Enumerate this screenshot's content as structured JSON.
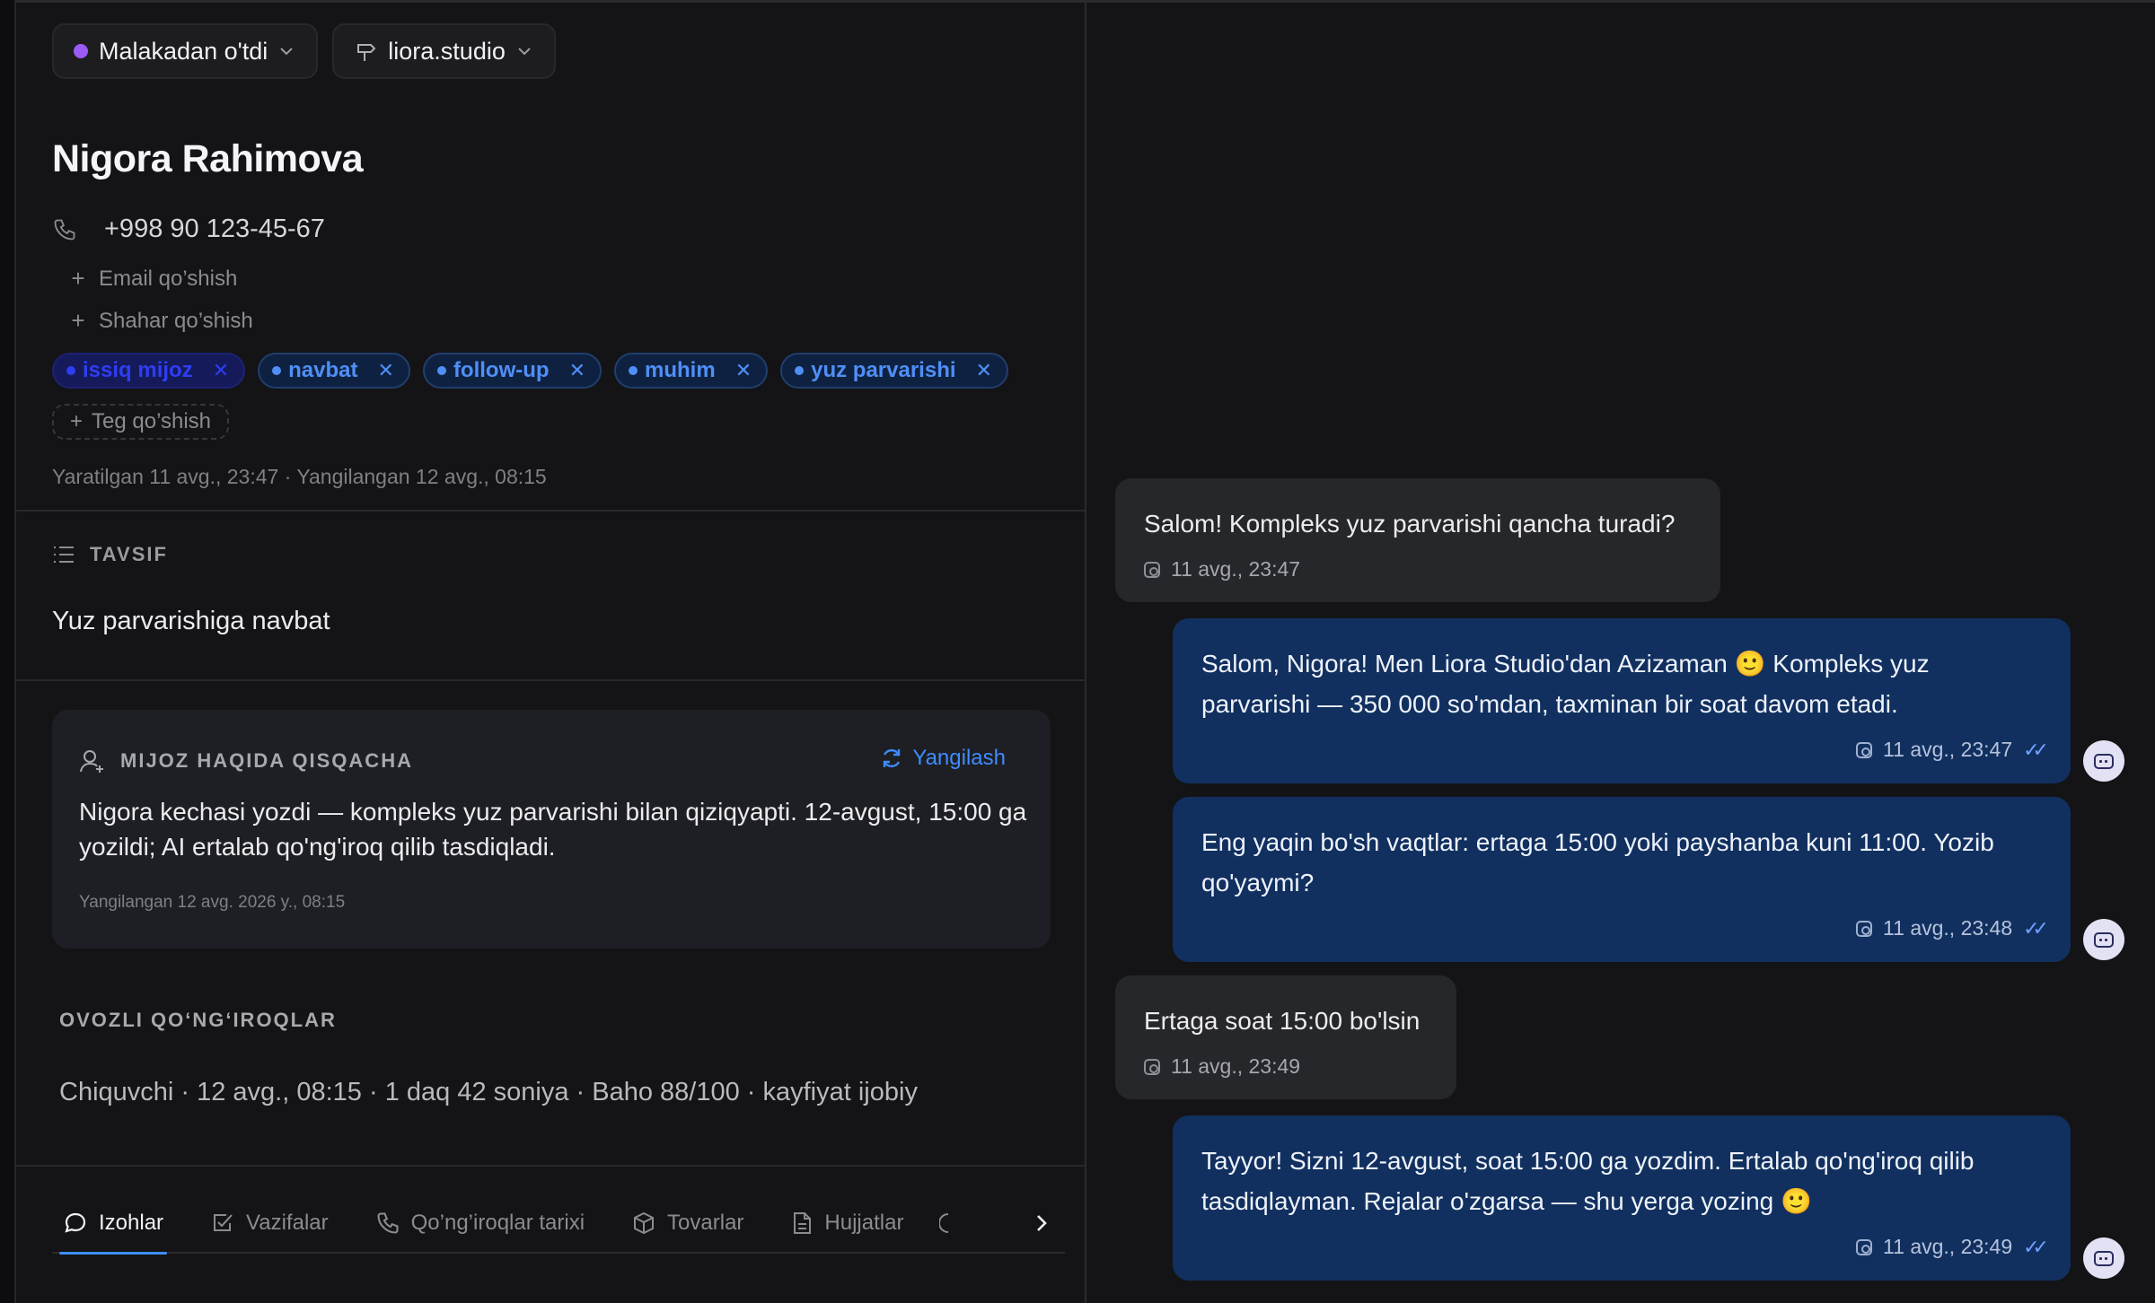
{
  "header": {
    "status_label": "Malakadan o'tdi",
    "status_color": "#9b5cf6",
    "channel_label": "liora.studio"
  },
  "contact": {
    "name": "Nigora Rahimova",
    "phone": "+998 90 123-45-67",
    "add_email": "Email qo’shish",
    "add_city": "Shahar qo’shish",
    "tags": [
      "issiq mijoz",
      "navbat",
      "follow-up",
      "muhim",
      "yuz parvarishi"
    ],
    "add_tag": "Teg qo’shish",
    "meta": "Yaratilgan 11 avg., 23:47 · Yangilangan 12 avg., 08:15"
  },
  "description": {
    "heading": "TAVSIF",
    "text": "Yuz parvarishiga navbat"
  },
  "summary": {
    "heading": "MIJOZ HAQIDA QISQACHA",
    "refresh_label": "Yangilash",
    "text": "Nigora kechasi yozdi — kompleks yuz parvarishi bilan qiziqyapti. 12-avgust, 15:00 ga yozildi; AI ertalab qo'ng'iroq qilib tasdiqladi.",
    "updated": "Yangilangan 12 avg. 2026 y., 08:15"
  },
  "calls": {
    "heading": "OVOZLI QO‘NG‘IROQLAR",
    "line": "Chiquvchi · 12 avg., 08:15 · 1 daq 42 soniya · Baho 88/100 · kayfiyat ijobiy"
  },
  "tabs": [
    {
      "label": "Izohlar",
      "icon": "chat-bubble-icon",
      "active": true
    },
    {
      "label": "Vazifalar",
      "icon": "checkbox-icon",
      "active": false
    },
    {
      "label": "Qo’ng’iroqlar tarixi",
      "icon": "phone-icon",
      "active": false
    },
    {
      "label": "Tovarlar",
      "icon": "box-icon",
      "active": false
    },
    {
      "label": "Hujjatlar",
      "icon": "document-icon",
      "active": false
    }
  ],
  "messages": [
    {
      "direction": "in",
      "text": "Salom! Kompleks yuz parvarishi qancha turadi?",
      "time": "11 avg., 23:47"
    },
    {
      "direction": "out",
      "text": "Salom, Nigora! Men Liora Studio'dan Azizaman 🙂 Kompleks yuz parvarishi — 350 000 so'mdan, taxminan bir soat davom etadi.",
      "time": "11 avg., 23:47"
    },
    {
      "direction": "out",
      "text": "Eng yaqin bo'sh vaqtlar: ertaga 15:00 yoki payshanba kuni 11:00. Yozib qo'yaymi?",
      "time": "11 avg., 23:48"
    },
    {
      "direction": "in",
      "text": "Ertaga soat 15:00 bo'lsin",
      "time": "11 avg., 23:49"
    },
    {
      "direction": "out",
      "text": "Tayyor! Sizni 12-avgust, soat 15:00 ga yozdim. Ertalab qo'ng'iroq qilib tasdiqlayman. Rejalar o'zgarsa — shu yerga yozing 🙂",
      "time": "11 avg., 23:49"
    }
  ],
  "colors": {
    "accent": "#3f8cff",
    "outgoing_bubble": "#11305f",
    "incoming_bubble": "#26272b",
    "tag_text": "#4f8ff7"
  }
}
